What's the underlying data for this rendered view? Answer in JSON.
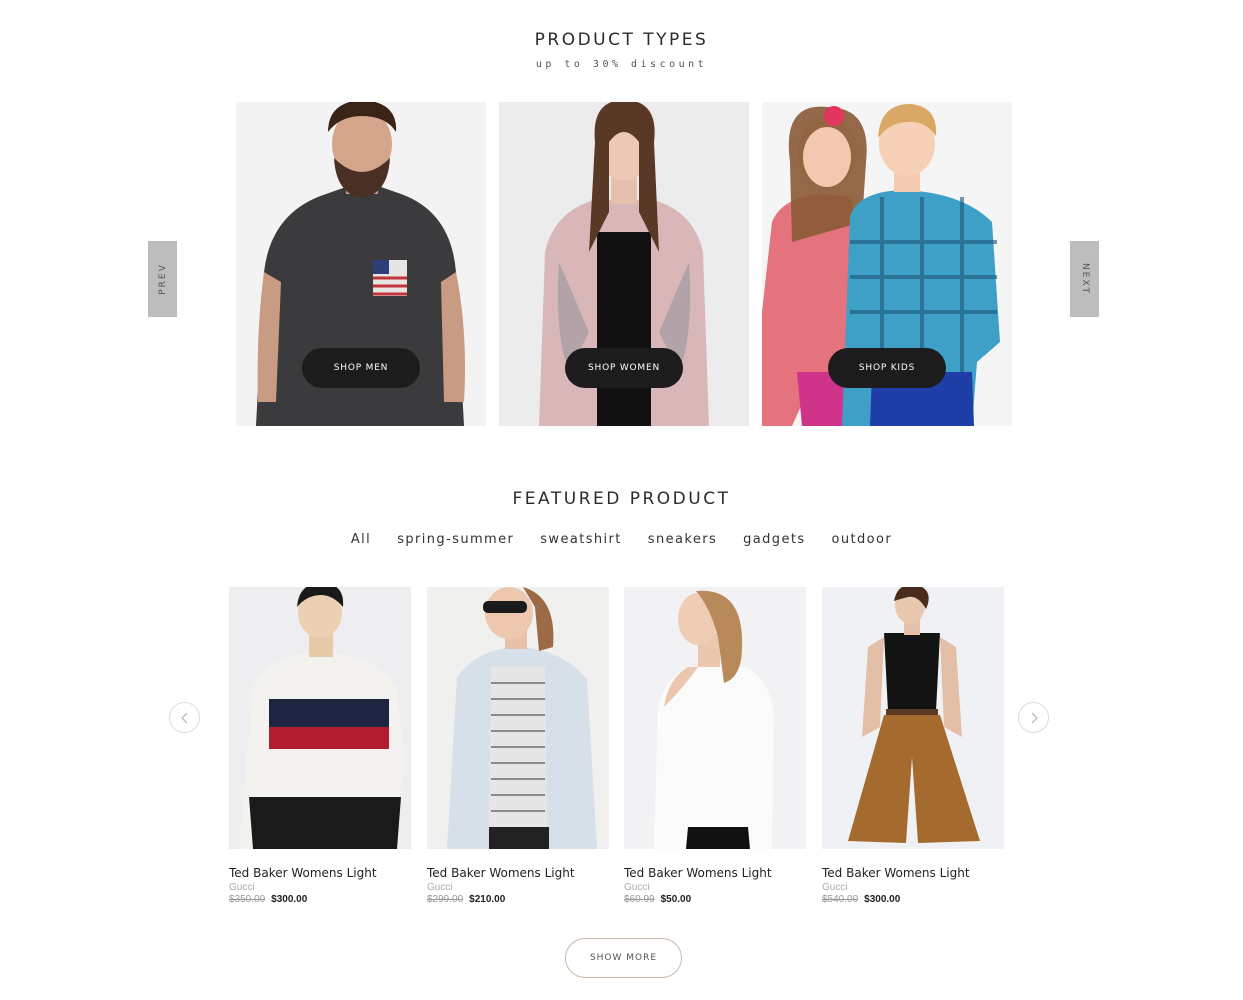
{
  "product_types": {
    "title": "PRODUCT TYPES",
    "subtitle": "up to 30% discount",
    "prev_label": "PREV",
    "next_label": "NEXT",
    "cards": [
      {
        "button": "SHOP MEN"
      },
      {
        "button": "SHOP WOMEN"
      },
      {
        "button": "SHOP KIDS"
      }
    ]
  },
  "featured": {
    "title": "FEATURED PRODUCT",
    "filters": [
      "All",
      "spring-summer",
      "sweatshirt",
      "sneakers",
      "gadgets",
      "outdoor"
    ],
    "products": [
      {
        "name": "Ted Baker Womens Light",
        "brand": "Gucci",
        "old_price": "$350.00",
        "price": "$300.00"
      },
      {
        "name": "Ted Baker Womens Light",
        "brand": "Gucci",
        "old_price": "$299.00",
        "price": "$210.00"
      },
      {
        "name": "Ted Baker Womens Light",
        "brand": "Gucci",
        "old_price": "$60.99",
        "price": "$50.00"
      },
      {
        "name": "Ted Baker Womens Light",
        "brand": "Gucci",
        "old_price": "$540.00",
        "price": "$300.00"
      }
    ],
    "prev_icon": "chevron-left-icon",
    "next_icon": "chevron-right-icon",
    "show_more": "SHOW MORE"
  },
  "colors": {
    "button_dark": "#1c1c1c",
    "tab_gray": "#bdbdbd",
    "show_more_border": "#c9b9a5"
  }
}
